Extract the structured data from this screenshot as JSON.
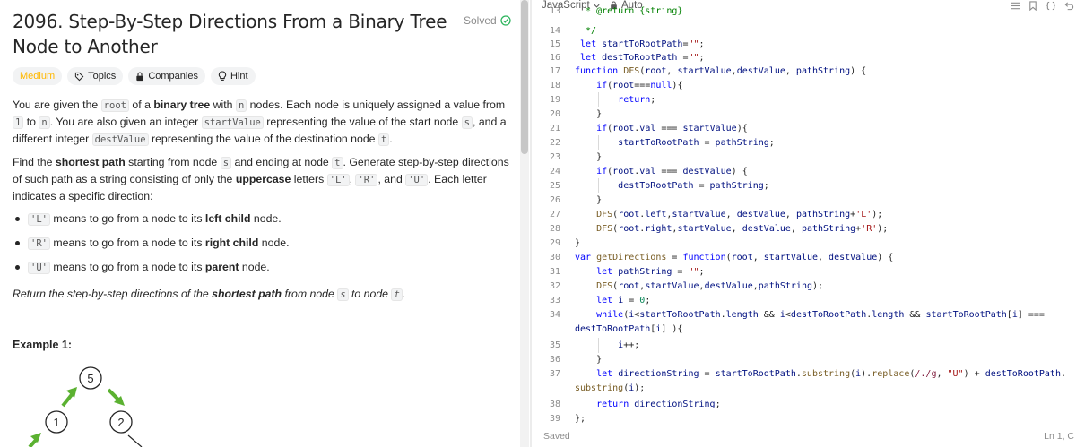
{
  "problem": {
    "title": "2096. Step-By-Step Directions From a Binary Tree Node to Another",
    "solved_label": "Solved",
    "tags": {
      "difficulty": "Medium",
      "topics": "Topics",
      "companies": "Companies",
      "hint": "Hint"
    },
    "example_label": "Example 1:",
    "tree_nodes": [
      "5",
      "1",
      "2"
    ]
  },
  "editor": {
    "language": "JavaScript",
    "mode": "Auto",
    "status": "Saved",
    "cursor": "Ln 1, C",
    "line_numbers": [
      "13",
      "14",
      "15",
      "16",
      "17",
      "18",
      "19",
      "20",
      "21",
      "22",
      "23",
      "24",
      "25",
      "26",
      "27",
      "28",
      "29",
      "30",
      "31",
      "32",
      "33",
      "34",
      "35",
      "36",
      "37",
      "38",
      "39"
    ]
  },
  "colors": {
    "medium": "#ffb800",
    "solved": "#2db55d",
    "arrow": "#5bb131",
    "keyword": "#0000ff",
    "string": "#a31515"
  },
  "icons": [
    "chevron-down-icon",
    "lock-icon",
    "tag-icon",
    "lock-icon",
    "bulb-icon",
    "check-circle-icon",
    "list-icon",
    "bookmark-icon",
    "braces-icon",
    "undo-icon"
  ]
}
